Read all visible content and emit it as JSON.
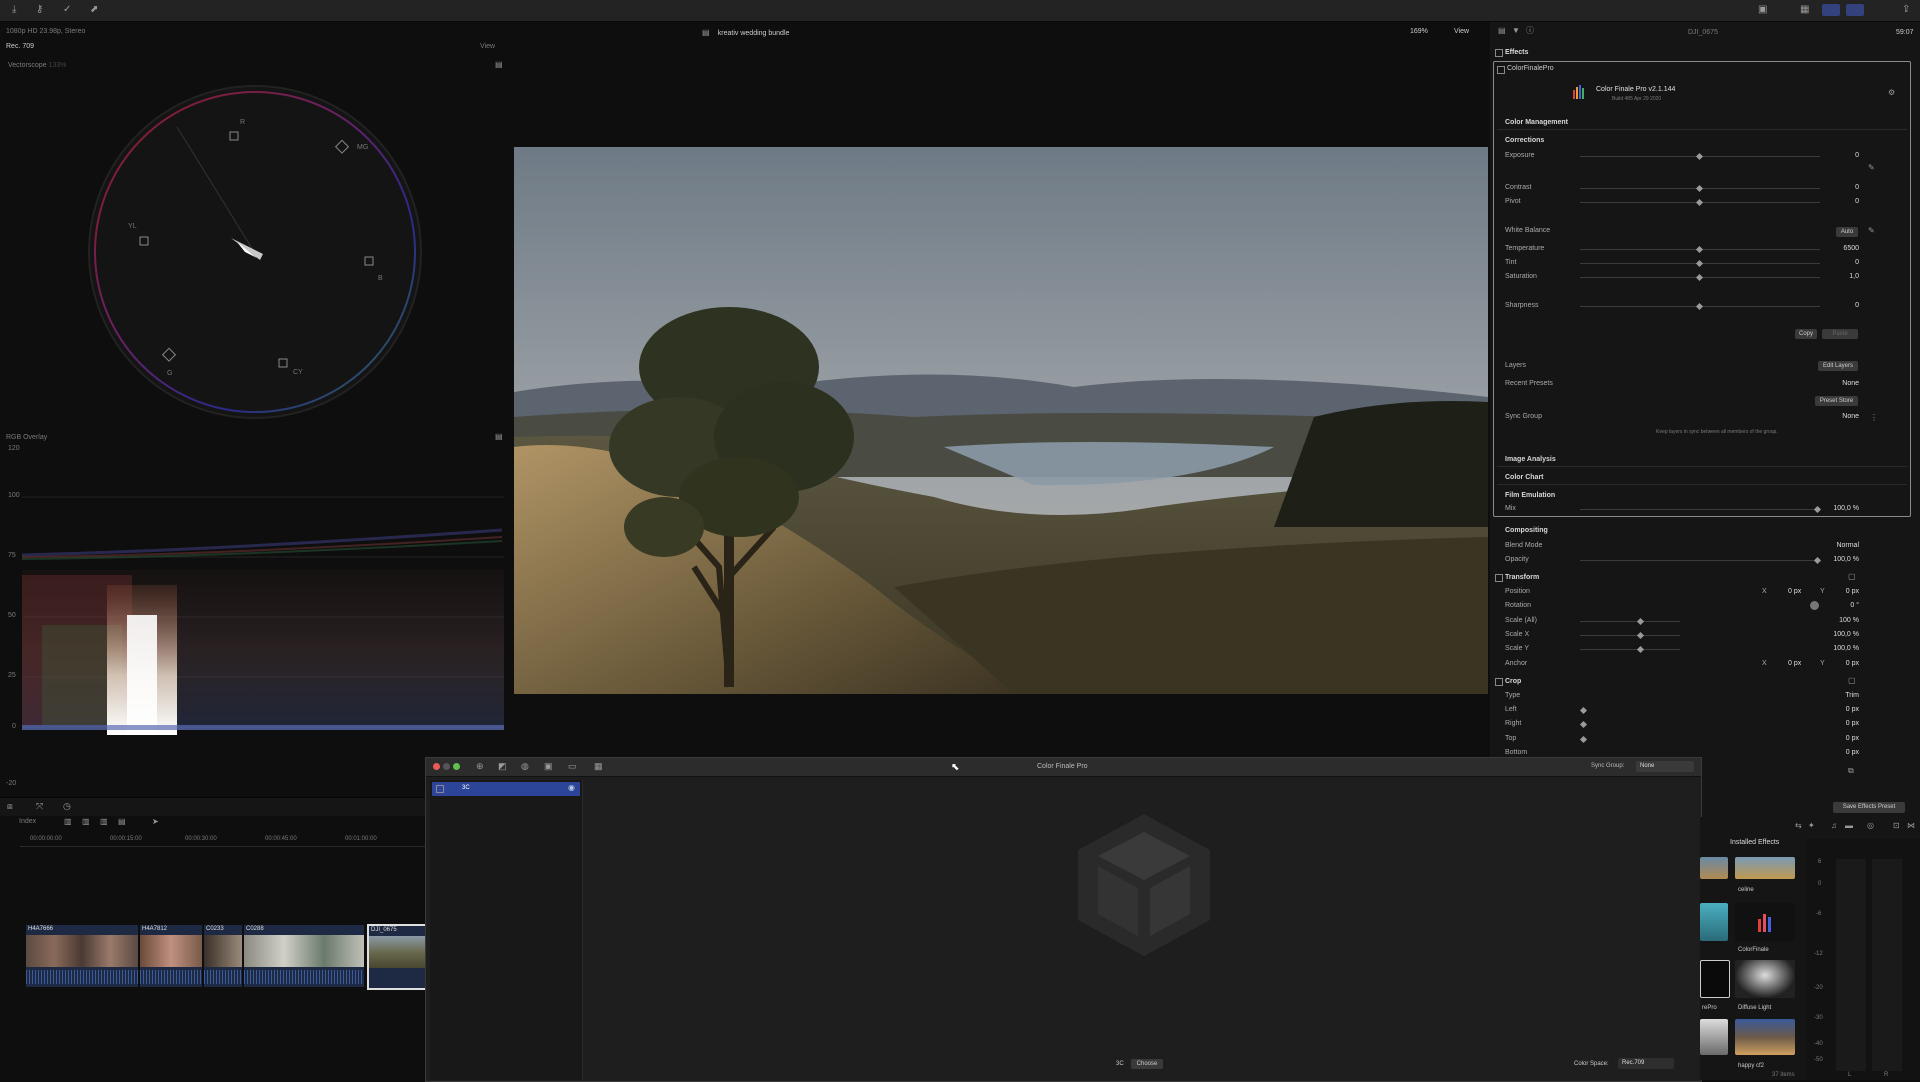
{
  "top_bar": {
    "project": "kreativ wedding bundle",
    "zoom": "169%",
    "view": "View",
    "clip_name": "DJI_0675",
    "timecode": "59:07"
  },
  "left": {
    "format": "1080p HD 23.98p, Stereo",
    "space": "Rec. 709",
    "view": "View",
    "vectorscope": {
      "title": "Vectorscope",
      "zoom": "133%",
      "targets": [
        "R",
        "MG",
        "YL",
        "B",
        "G",
        "CY"
      ]
    },
    "waveform": {
      "title": "RGB Overlay",
      "scale": [
        "120",
        "100",
        "75",
        "50",
        "25",
        "0",
        "-20"
      ]
    }
  },
  "inspector": {
    "effects_header": "Effects",
    "plugin": {
      "checkbox_label": "ColorFinalePro",
      "name": "Color Finale Pro v2.1.144",
      "build": "Build 485 Apr 29 2020"
    },
    "color_management": "Color Management",
    "corrections": "Corrections",
    "rows": [
      {
        "label": "Exposure",
        "value": "0",
        "level": 0.5
      },
      {
        "label": "Contrast",
        "value": "0",
        "level": 0.5
      },
      {
        "label": "Pivot",
        "value": "0",
        "level": 0.5
      },
      {
        "label": "Temperature",
        "value": "6500",
        "level": 0.5
      },
      {
        "label": "Tint",
        "value": "0",
        "level": 0.5
      },
      {
        "label": "Saturation",
        "value": "1,0",
        "level": 0.5
      },
      {
        "label": "Sharpness",
        "value": "0",
        "level": 0.5
      }
    ],
    "white_balance": "White Balance",
    "auto": "Auto",
    "copy": "Copy",
    "paste": "Paste",
    "layers": "Layers",
    "edit_layers": "Edit Layers",
    "recent_presets": "Recent Presets",
    "recent_presets_value": "None",
    "preset_store": "Preset Store",
    "sync_group": "Sync Group",
    "sync_group_value": "None",
    "sync_note": "Keep layers in sync between all members of the group.",
    "image_analysis": "Image Analysis",
    "color_chart": "Color Chart",
    "film_emulation": "Film Emulation",
    "mix_label": "Mix",
    "mix_value": "100,0 %",
    "compositing": "Compositing",
    "blend_mode": "Blend Mode",
    "blend_value": "Normal",
    "opacity": "Opacity",
    "opacity_value": "100,0 %",
    "transform": "Transform",
    "position": "Position",
    "pos_x": "0 px",
    "pos_y": "0 px",
    "rotation": "Rotation",
    "rotation_value": "0 °",
    "scale_all": "Scale (All)",
    "scale_all_value": "100 %",
    "scale_x": "Scale X",
    "scale_x_value": "100,0 %",
    "scale_y": "Scale Y",
    "scale_y_value": "100,0 %",
    "anchor": "Anchor",
    "anchor_x": "0 px",
    "anchor_y": "0 px",
    "crop": "Crop",
    "type": "Type",
    "type_value": "Trim",
    "left": "Left",
    "left_value": "0 px",
    "right": "Right",
    "right_value": "0 px",
    "top": "Top",
    "top_value": "0 px",
    "bottom": "Bottom",
    "bottom_value": "0 px",
    "x": "X",
    "y": "Y",
    "save_preset": "Save Effects Preset"
  },
  "timeline": {
    "index": "Index",
    "timecodes": [
      "00:00:00:00",
      "00:00:15:00",
      "00:00:30:00",
      "00:00:45:00",
      "00:01:00:00"
    ],
    "clips": [
      "H4A7666",
      "H4A7812",
      "C0233",
      "C0288",
      "DJI_0675"
    ]
  },
  "cfp_window": {
    "title": "Color Finale Pro",
    "sync_group_label": "Sync Group:",
    "sync_group_value": "None",
    "layer_name": "3C",
    "bottom_label": "3C",
    "choose": "Choose",
    "color_space_label": "Color Space:",
    "color_space_value": "Rec.709"
  },
  "effects_browser": {
    "title": "Installed Effects",
    "items": [
      "celine",
      "ColorFinale",
      "Diffuse Light",
      "happy cf2",
      "rePro"
    ],
    "count": "37 items"
  },
  "meter": {
    "scale": [
      "6",
      "0",
      "-6",
      "-12",
      "-20",
      "-30",
      "-40",
      "-50"
    ],
    "channels": [
      "L",
      "R"
    ]
  }
}
